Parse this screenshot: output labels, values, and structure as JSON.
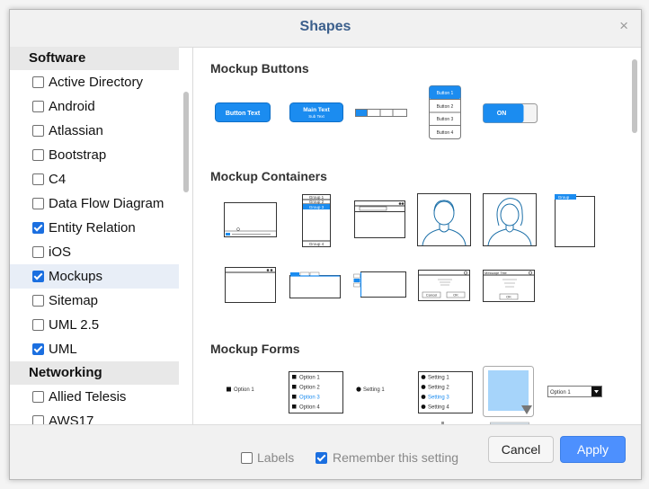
{
  "dialog": {
    "title": "Shapes",
    "close_glyph": "×"
  },
  "sidebar": {
    "sections": [
      {
        "heading": "Software",
        "items": [
          {
            "label": "Active Directory",
            "checked": false,
            "selected": false
          },
          {
            "label": "Android",
            "checked": false,
            "selected": false
          },
          {
            "label": "Atlassian",
            "checked": false,
            "selected": false
          },
          {
            "label": "Bootstrap",
            "checked": false,
            "selected": false
          },
          {
            "label": "C4",
            "checked": false,
            "selected": false
          },
          {
            "label": "Data Flow Diagram",
            "checked": false,
            "selected": false
          },
          {
            "label": "Entity Relation",
            "checked": true,
            "selected": false
          },
          {
            "label": "iOS",
            "checked": false,
            "selected": false
          },
          {
            "label": "Mockups",
            "checked": true,
            "selected": true
          },
          {
            "label": "Sitemap",
            "checked": false,
            "selected": false
          },
          {
            "label": "UML 2.5",
            "checked": false,
            "selected": false
          },
          {
            "label": "UML",
            "checked": true,
            "selected": false
          }
        ]
      },
      {
        "heading": "Networking",
        "items": [
          {
            "label": "Allied Telesis",
            "checked": false,
            "selected": false
          },
          {
            "label": "AWS17",
            "checked": false,
            "selected": false
          }
        ]
      }
    ]
  },
  "main": {
    "groups": {
      "buttons": "Mockup Buttons",
      "containers": "Mockup Containers",
      "forms": "Mockup Forms"
    },
    "thumb_text": {
      "button_text": "Button Text",
      "main_text": "Main Text",
      "sub_text": "Sub Text",
      "button_1": "Button 1",
      "button_2": "Button 2",
      "button_3": "Button 3",
      "button_4": "Button 4",
      "on": "ON",
      "group_1": "Group 1",
      "group_2": "Group 2",
      "group_3": "Group 3",
      "group_4": "Group 4",
      "group": "Group",
      "option_1": "Option 1",
      "option_2": "Option 2",
      "option_3": "Option 3",
      "option_4": "Option 4",
      "setting_1": "Setting 1",
      "setting_2": "Setting 2",
      "setting_3": "Setting 3",
      "setting_4": "Setting 4",
      "cancel": "Cancel",
      "ok": "OK",
      "message_title": "Message Title"
    }
  },
  "footer": {
    "labels_text": "Labels",
    "labels_checked": false,
    "remember_text": "Remember this setting",
    "remember_checked": true,
    "cancel_label": "Cancel",
    "apply_label": "Apply"
  },
  "colors": {
    "accent": "#4d90fe",
    "title": "#3b5f8c",
    "mock_blue": "#1b8cf0",
    "avatar_line": "#1b6fa8"
  }
}
